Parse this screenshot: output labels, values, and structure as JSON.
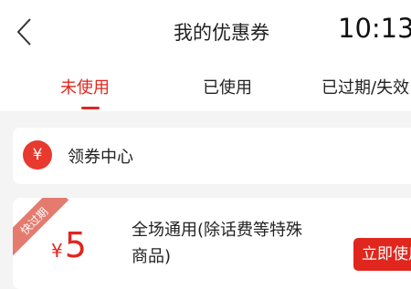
{
  "header": {
    "title": "我的优惠券",
    "clock": "10:13",
    "back_icon": "chevron-left-icon"
  },
  "tabs": [
    {
      "label": "未使用",
      "active": true
    },
    {
      "label": "已使用",
      "active": false
    },
    {
      "label": "已过期/失效",
      "active": false
    }
  ],
  "coupon_center": {
    "icon_glyph": "¥",
    "label": "领券中心"
  },
  "coupon": {
    "badge": "快过期",
    "currency": "¥",
    "amount": "5",
    "description": "全场通用(除话费等特殊商品)",
    "button": "立即使用"
  },
  "colors": {
    "accent": "#e0261d",
    "badge": "#e57b6f",
    "background": "#f4f4f4"
  }
}
